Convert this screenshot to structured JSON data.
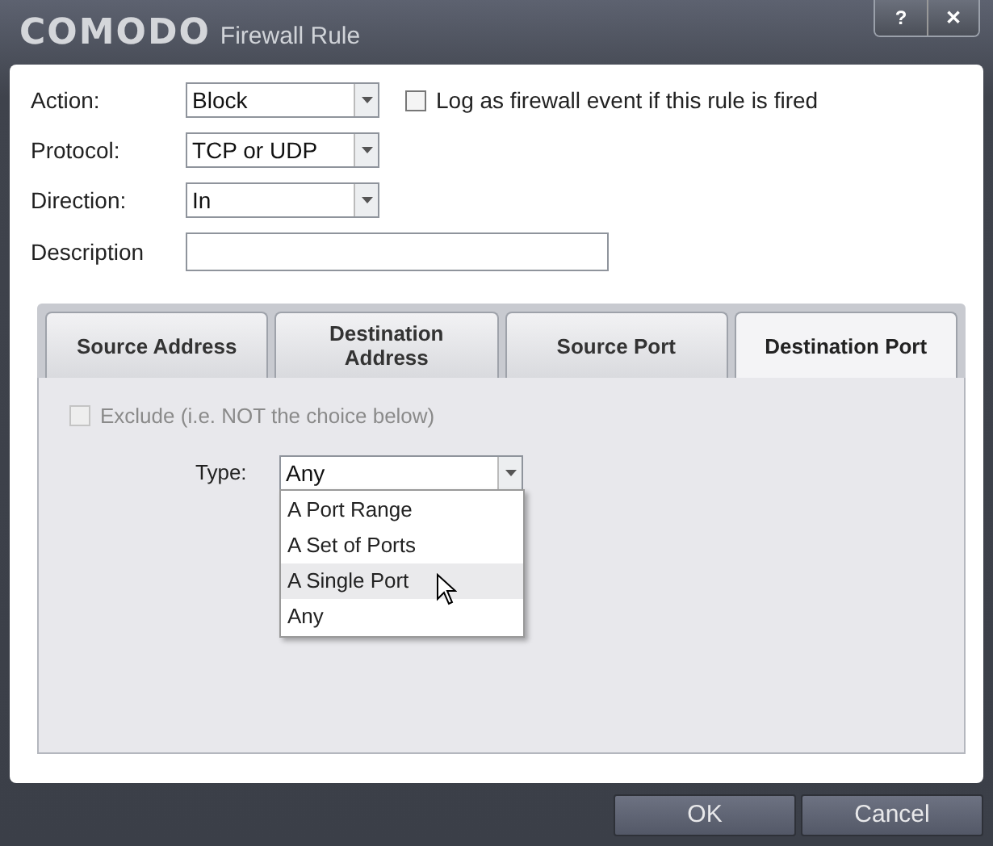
{
  "window": {
    "logo": "COMODO",
    "title": "Firewall Rule",
    "controls": [
      "?",
      "✕"
    ]
  },
  "fields": [
    {
      "kind": "dropdown",
      "label": "Action:",
      "value": "Block"
    },
    {
      "kind": "dropdown",
      "label": "Protocol:",
      "value": "TCP or UDP"
    },
    {
      "kind": "dropdown",
      "label": "Direction:",
      "value": "In"
    },
    {
      "kind": "text",
      "label": "Description"
    }
  ],
  "log_checkbox": {
    "label": "Log as firewall event if this rule is fired",
    "checked": false
  },
  "tabs": [
    {
      "label": "Source Address",
      "selected": false
    },
    {
      "label": "Destination Address",
      "selected": false
    },
    {
      "label": "Source Port",
      "selected": false
    },
    {
      "label": "Destination Port",
      "selected": true
    }
  ],
  "exclude_checkbox": {
    "label": "Exclude (i.e. NOT the choice below)",
    "checked": false,
    "disabled": true
  },
  "type": {
    "label": "Type:",
    "value": "Any",
    "expanded": true,
    "options": [
      {
        "label": "A Port Range",
        "highlighted": false
      },
      {
        "label": "A Set of Ports",
        "highlighted": false
      },
      {
        "label": "A Single Port",
        "highlighted": true
      },
      {
        "label": "Any",
        "highlighted": false
      }
    ]
  },
  "buttons": [
    "OK",
    "Cancel"
  ]
}
